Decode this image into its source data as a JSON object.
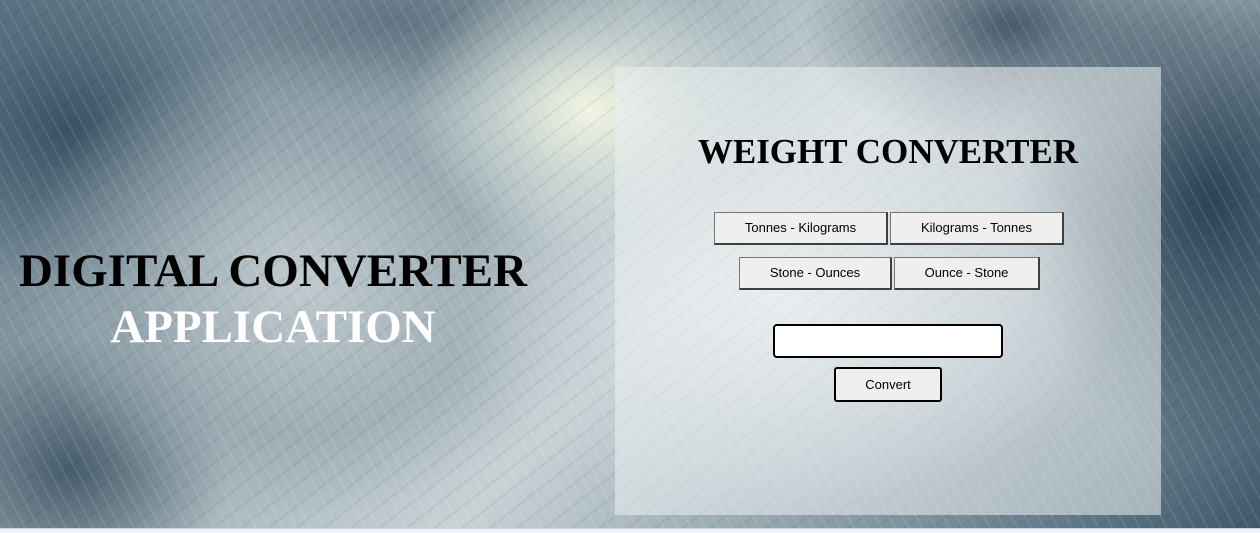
{
  "app": {
    "title_line1": "DIGITAL CONVERTER",
    "title_line2": "APPLICATION"
  },
  "converter": {
    "heading": "WEIGHT CONVERTER",
    "mode_buttons": [
      {
        "label": "Tonnes - Kilograms"
      },
      {
        "label": "Kilograms - Tonnes"
      },
      {
        "label": "Stone - Ounces"
      },
      {
        "label": "Ounce - Stone"
      }
    ],
    "input": {
      "value": "",
      "placeholder": ""
    },
    "convert_label": "Convert"
  },
  "colors": {
    "title_primary": "#000000",
    "title_secondary": "#ffffff",
    "panel_background": "#eceff2"
  }
}
